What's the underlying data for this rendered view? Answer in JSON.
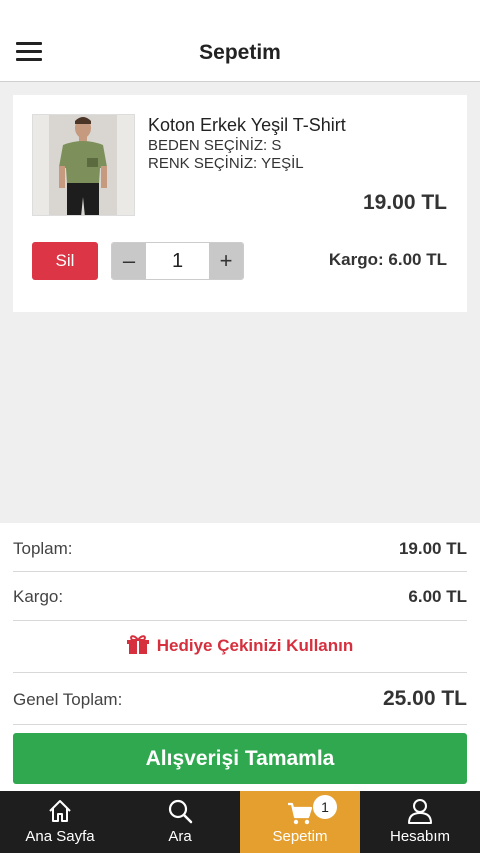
{
  "header": {
    "title": "Sepetim",
    "menu_icon": "hamburger-menu-icon"
  },
  "cart_item": {
    "name": "Koton Erkek Yeşil T-Shirt",
    "size": "BEDEN SEÇİNİZ: S",
    "color": "RENK SEÇİNİZ: YEŞİL",
    "price": "19.00 TL",
    "delete_label": "Sil",
    "quantity": "1",
    "minus_label": "–",
    "plus_label": "+",
    "shipping": "Kargo: 6.00 TL",
    "image": "tshirt-product-image"
  },
  "summary": {
    "subtotal_label": "Toplam:",
    "subtotal_value": "19.00 TL",
    "shipping_label": "Kargo:",
    "shipping_value": "6.00 TL",
    "gift_label": "Hediye Çekinizi Kullanın",
    "gift_icon": "gift-icon",
    "grand_label": "Genel Toplam:",
    "grand_value": "25.00 TL"
  },
  "checkout_label": "Alışverişi Tamamla",
  "tabs": [
    {
      "label": "Ana Sayfa",
      "icon": "home-icon"
    },
    {
      "label": "Ara",
      "icon": "search-icon"
    },
    {
      "label": "Sepetim",
      "icon": "cart-icon",
      "badge": "1"
    },
    {
      "label": "Hesabım",
      "icon": "user-icon"
    }
  ],
  "colors": {
    "danger": "#dc3545",
    "success": "#2fa84f",
    "active_tab": "#e59f2f",
    "tabbar": "#1e1e1e"
  }
}
